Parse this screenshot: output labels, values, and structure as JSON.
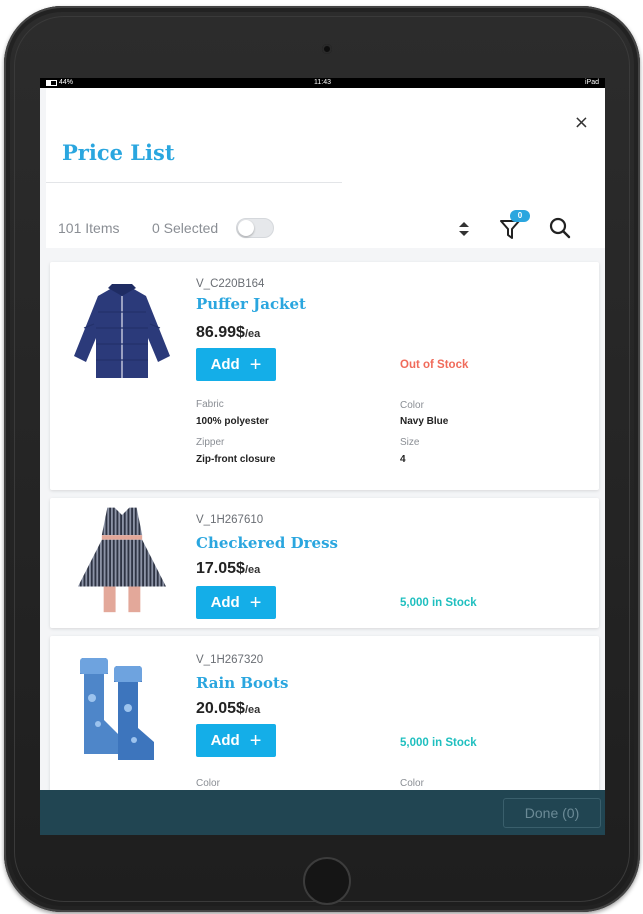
{
  "status_bar": {
    "left": "44%",
    "time": "11:43",
    "right": "iPad"
  },
  "header": {
    "title": "Price List",
    "close_label": "×"
  },
  "toolbar": {
    "items_count": "101 Items",
    "selected_count": "0 Selected",
    "filter_badge": "0"
  },
  "products": [
    {
      "sku": "V_C220B164",
      "name": "Puffer Jacket",
      "price": "86.99$",
      "unit": "/ea",
      "add_label": "Add",
      "stock": "Out of Stock",
      "attributes": [
        {
          "label": "Fabric",
          "value": "100% polyester"
        },
        {
          "label": "Color",
          "value": "Navy Blue"
        },
        {
          "label": "Zipper",
          "value": "Zip-front closure"
        },
        {
          "label": "Size",
          "value": "4"
        }
      ]
    },
    {
      "sku": "V_1H267610",
      "name": "Checkered Dress",
      "price": "17.05$",
      "unit": "/ea",
      "add_label": "Add",
      "stock": "5,000 in Stock"
    },
    {
      "sku": "V_1H267320",
      "name": "Rain Boots",
      "price": "20.05$",
      "unit": "/ea",
      "add_label": "Add",
      "stock": "5,000 in Stock",
      "attributes": [
        {
          "label": "Color",
          "value": ""
        },
        {
          "label": "Color",
          "value": ""
        }
      ]
    }
  ],
  "footer": {
    "done_label": "Done (0)"
  },
  "colors": {
    "accent": "#2aa6df",
    "button": "#14aee8",
    "out_of_stock": "#f06a5a",
    "in_stock": "#1fbfbf",
    "footer": "#214552"
  }
}
